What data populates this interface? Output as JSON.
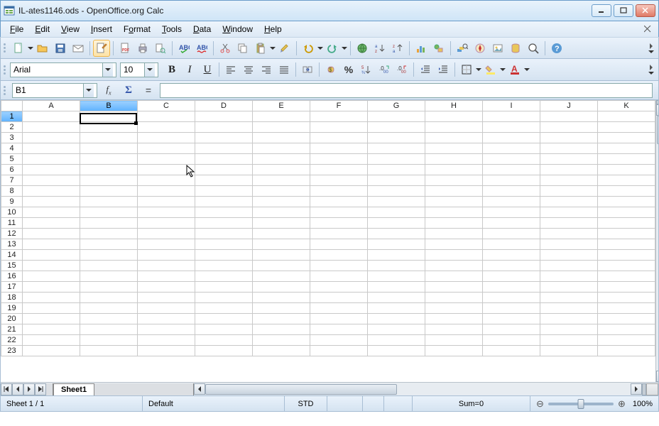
{
  "window": {
    "title": "IL-ates1146.ods - OpenOffice.org Calc"
  },
  "menu": {
    "file": "File",
    "edit": "Edit",
    "view": "View",
    "insert": "Insert",
    "format": "Format",
    "tools": "Tools",
    "data": "Data",
    "window": "Window",
    "help": "Help"
  },
  "font": {
    "name": "Arial",
    "size": "10"
  },
  "namebox": "B1",
  "columns": [
    "A",
    "B",
    "C",
    "D",
    "E",
    "F",
    "G",
    "H",
    "I",
    "J",
    "K"
  ],
  "selected": {
    "col": "B",
    "row": 1
  },
  "rows": 23,
  "sheet_tab": "Sheet1",
  "status": {
    "sheet": "Sheet 1 / 1",
    "style": "Default",
    "mode": "STD",
    "sum": "Sum=0",
    "zoom": "100%"
  }
}
